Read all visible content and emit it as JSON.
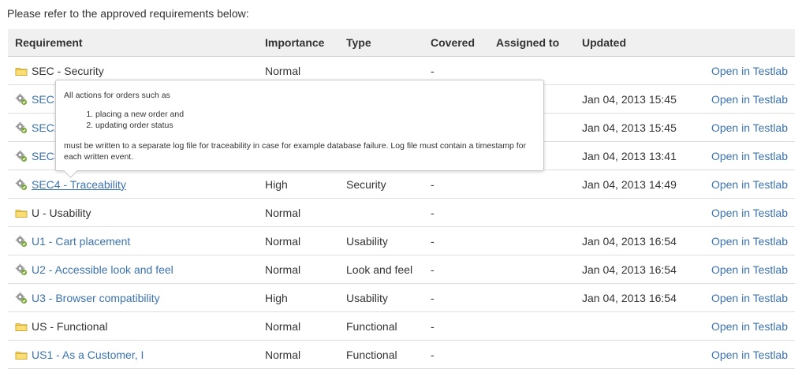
{
  "intro_text": "Please refer to the approved requirements below:",
  "columns": [
    "Requirement",
    "Importance",
    "Type",
    "Covered",
    "Assigned to",
    "Updated",
    ""
  ],
  "rows": [
    {
      "kind": "folder",
      "name": "SEC - Security",
      "importance": "Normal",
      "type": "",
      "covered": "-",
      "assigned": "",
      "updated": "",
      "open": "Open in Testlab",
      "icon": "folder-icon"
    },
    {
      "kind": "req",
      "name": "SEC1",
      "importance": "",
      "type": "",
      "covered": "",
      "assigned": "",
      "updated": "Jan 04, 2013 15:45",
      "open": "Open in Testlab",
      "icon": "gear-icon"
    },
    {
      "kind": "req",
      "name": "SEC2",
      "importance": "",
      "type": "",
      "covered": "",
      "assigned": "",
      "updated": "Jan 04, 2013 15:45",
      "open": "Open in Testlab",
      "icon": "gear-icon"
    },
    {
      "kind": "req",
      "name": "SEC3",
      "importance": "",
      "type": "",
      "covered": "",
      "assigned": "",
      "updated": "Jan 04, 2013 13:41",
      "open": "Open in Testlab",
      "icon": "gear-icon"
    },
    {
      "kind": "req",
      "name": "SEC4 - Traceability",
      "importance": "High",
      "type": "Security",
      "covered": "-",
      "assigned": "",
      "updated": "Jan 04, 2013 14:49",
      "open": "Open in Testlab",
      "icon": "gear-icon",
      "hover": true
    },
    {
      "kind": "folder",
      "name": "U - Usability",
      "importance": "Normal",
      "type": "",
      "covered": "-",
      "assigned": "",
      "updated": "",
      "open": "Open in Testlab",
      "icon": "folder-icon"
    },
    {
      "kind": "req",
      "name": "U1 - Cart placement",
      "importance": "Normal",
      "type": "Usability",
      "covered": "-",
      "assigned": "",
      "updated": "Jan 04, 2013 16:54",
      "open": "Open in Testlab",
      "icon": "gear-icon"
    },
    {
      "kind": "req",
      "name": "U2 - Accessible look and feel",
      "importance": "Normal",
      "type": "Look and feel",
      "covered": "-",
      "assigned": "",
      "updated": "Jan 04, 2013 16:54",
      "open": "Open in Testlab",
      "icon": "gear-icon"
    },
    {
      "kind": "req",
      "name": "U3 - Browser compatibility",
      "importance": "High",
      "type": "Usability",
      "covered": "-",
      "assigned": "",
      "updated": "Jan 04, 2013 16:54",
      "open": "Open in Testlab",
      "icon": "gear-icon"
    },
    {
      "kind": "folder",
      "name": "US - Functional",
      "importance": "Normal",
      "type": "Functional",
      "covered": "-",
      "assigned": "",
      "updated": "",
      "open": "Open in Testlab",
      "icon": "folder-icon"
    },
    {
      "kind": "folderlink",
      "name": "US1 - As a Customer, I",
      "importance": "Normal",
      "type": "Functional",
      "covered": "-",
      "assigned": "",
      "updated": "",
      "open": "Open in Testlab",
      "icon": "folder-icon"
    }
  ],
  "tooltip": {
    "intro": "All actions for orders such as",
    "items": [
      "placing a new order and",
      "updating order status"
    ],
    "body": "must be written to a separate log file for traceability in case for example database failure. Log file must contain a timestamp for each written event."
  },
  "colors": {
    "link": "#3b73af",
    "header_bg": "#f0f0f0",
    "folder": "#f2c94c",
    "gear": "#7aa63a"
  }
}
